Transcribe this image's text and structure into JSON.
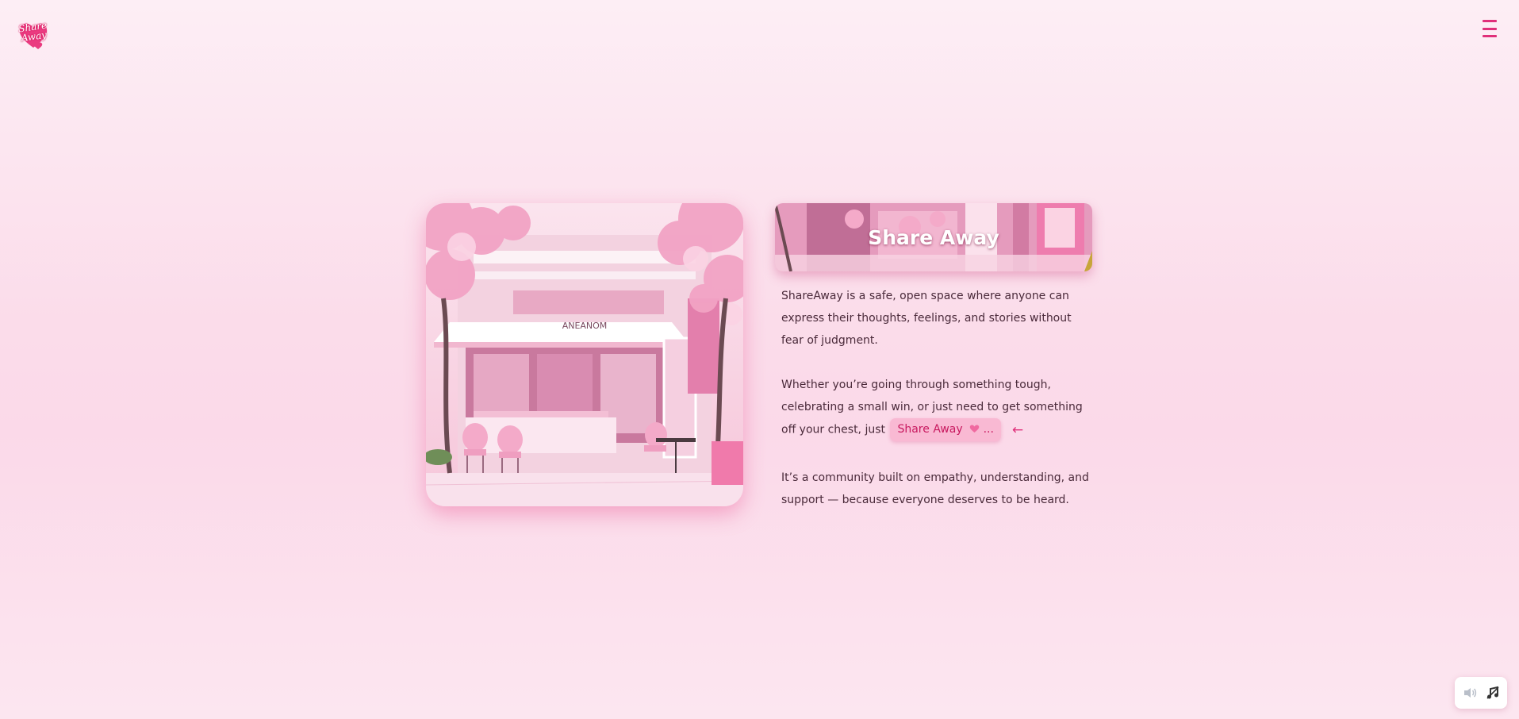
{
  "logo": {
    "text_line1": "Share",
    "text_line2": "Away",
    "color": "#e0307a"
  },
  "header": {
    "menu_icon": "hamburger-icon"
  },
  "banner": {
    "title": "Share Away"
  },
  "hero": {
    "storefront_sign": "ANEANOM"
  },
  "content": {
    "paragraph1": "ShareAway is a safe, open space where anyone can express their thoughts, feelings, and stories without fear of judgment.",
    "paragraph2_lead": "Whether you’re going through something tough, celebrating a small win, or just need to get something off your chest, just",
    "share_button": {
      "label": "Share Away",
      "icon": "heart-icon",
      "suffix": "..."
    },
    "arrow_icon": "←",
    "paragraph3": "It’s a community built on empathy, understanding, and support — because everyone deserves to be heard."
  },
  "sound_controls": {
    "volume_icon": "speaker-icon",
    "music_icon": "music-note-muted-icon"
  },
  "colors": {
    "accent": "#e0307a",
    "button_bg": "#f9b9d3",
    "text": "#4a2a3a"
  }
}
